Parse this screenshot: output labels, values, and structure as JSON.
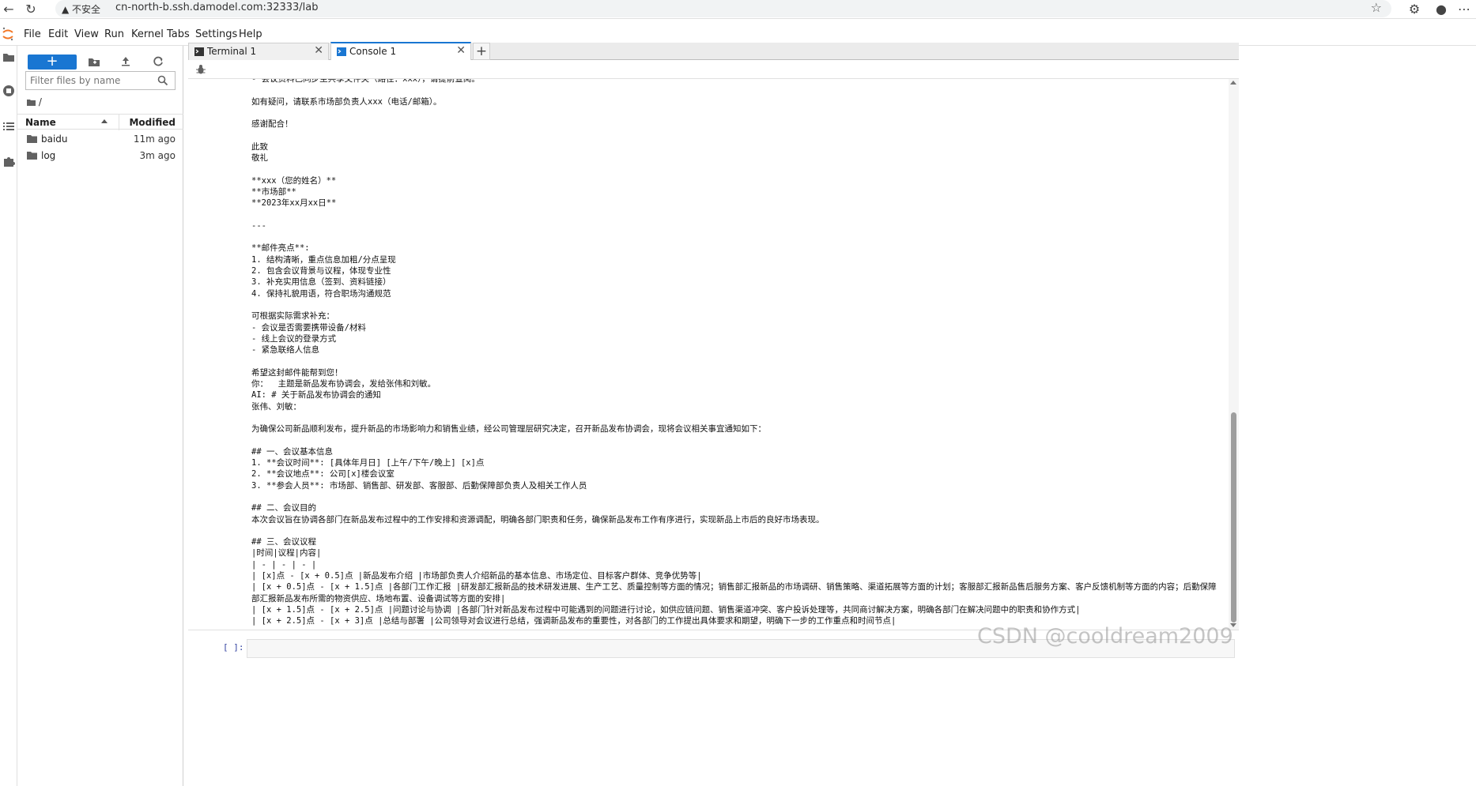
{
  "browser": {
    "insecure_label": "不安全",
    "url": "cn-north-b.ssh.damodel.com:32333/lab"
  },
  "menu": [
    "File",
    "Edit",
    "View",
    "Run",
    "Kernel",
    "Tabs",
    "Settings",
    "Help"
  ],
  "file_browser": {
    "new_label": "+",
    "filter_placeholder": "Filter files by name",
    "breadcrumb": "/",
    "col_name": "Name",
    "col_modified": "Modified",
    "files": [
      {
        "name": "baidu",
        "modified": "11m ago"
      },
      {
        "name": "log",
        "modified": "3m ago"
      }
    ]
  },
  "tabs": [
    {
      "label": "Terminal 1",
      "active": false
    },
    {
      "label": "Console 1",
      "active": true
    }
  ],
  "console": {
    "lines": [
      "- 会议资料已同步至共享文件夹（路径：xxx），请提前查阅。",
      "",
      "如有疑问，请联系市场部负责人xxx（电话/邮箱）。",
      "",
      "感谢配合！",
      "",
      "此致",
      "敬礼",
      "",
      "**xxx（您的姓名）**",
      "**市场部**",
      "**2023年xx月xx日**",
      "",
      "---",
      "",
      "**邮件亮点**:",
      "1. 结构清晰，重点信息加粗/分点呈现",
      "2. 包含会议背景与议程，体现专业性",
      "3. 补充实用信息（签到、资料链接）",
      "4. 保持礼貌用语，符合职场沟通规范",
      "",
      "可根据实际需求补充：",
      "- 会议是否需要携带设备/材料",
      "- 线上会议的登录方式",
      "- 紧急联络人信息",
      "",
      "希望这封邮件能帮到您！",
      "你：  主题是新品发布协调会，发给张伟和刘敏。",
      "AI: # 关于新品发布协调会的通知",
      "张伟、刘敏：",
      "",
      "为确保公司新品顺利发布，提升新品的市场影响力和销售业绩，经公司管理层研究决定，召开新品发布协调会，现将会议相关事宜通知如下：",
      "",
      "## 一、会议基本信息",
      "1. **会议时间**: [具体年月日] [上午/下午/晚上] [x]点",
      "2. **会议地点**: 公司[x]楼会议室",
      "3. **参会人员**: 市场部、销售部、研发部、客服部、后勤保障部负责人及相关工作人员",
      "",
      "## 二、会议目的",
      "本次会议旨在协调各部门在新品发布过程中的工作安排和资源调配，明确各部门职责和任务，确保新品发布工作有序进行，实现新品上市后的良好市场表现。",
      "",
      "## 三、会议议程",
      "|时间|议程|内容|",
      "| - | - | - |",
      "| [x]点 - [x + 0.5]点 |新品发布介绍 |市场部负责人介绍新品的基本信息、市场定位、目标客户群体、竞争优势等|",
      "| [x + 0.5]点 - [x + 1.5]点 |各部门工作汇报 |研发部汇报新品的技术研发进展、生产工艺、质量控制等方面的情况；销售部汇报新品的市场调研、销售策略、渠道拓展等方面的计划；客服部汇报新品售后服务方案、客户反馈机制等方面的内容；后勤保障部汇报新品发布所需的物资供应、场地布置、设备调试等方面的安排|",
      "| [x + 1.5]点 - [x + 2.5]点 |问题讨论与协调 |各部门针对新品发布过程中可能遇到的问题进行讨论，如供应链问题、销售渠道冲突、客户投诉处理等，共同商讨解决方案，明确各部门在解决问题中的职责和协作方式|",
      "| [x + 2.5]点 - [x + 3]点 |总结与部署 |公司领导对会议进行总结，强调新品发布的重要性，对各部门的工作提出具体要求和期望，明确下一步的工作重点和时间节点|"
    ],
    "prompt": "[ ]:"
  },
  "watermark": "CSDN @cooldream2009",
  "colors": {
    "accent": "#1976d2",
    "prompt": "#303f9f"
  }
}
